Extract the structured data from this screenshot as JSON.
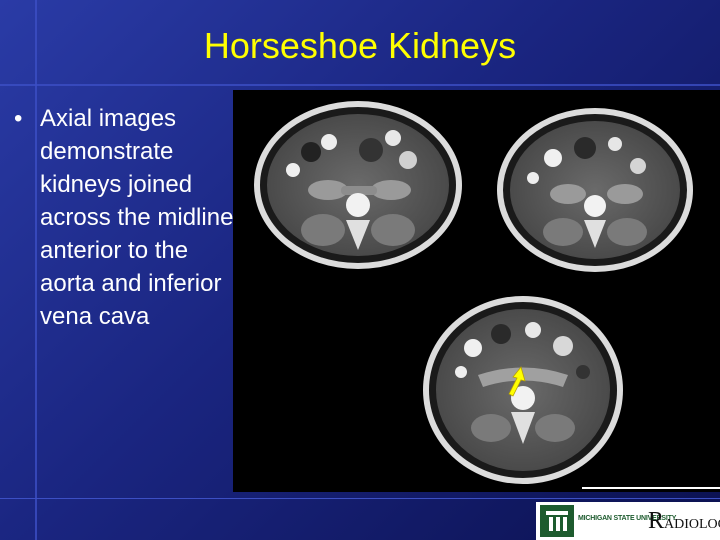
{
  "slide": {
    "title": "Horseshoe Kidneys",
    "bullets": [
      {
        "marker": "•",
        "text": "Axial images demonstrate kidneys joined across the midline anterior to the aorta and inferior vena cava"
      }
    ]
  },
  "images": [
    {
      "name": "axial-ct-upper-left",
      "has_arrow": false
    },
    {
      "name": "axial-ct-upper-right",
      "has_arrow": false
    },
    {
      "name": "axial-ct-lower",
      "has_arrow": true,
      "arrow_color": "#ffff00"
    }
  ],
  "logo": {
    "university": "MICHIGAN STATE UNIVERSITY",
    "dept_initial": "R",
    "dept_rest": "ADIOLOGY",
    "brand_color": "#1d5b2e"
  },
  "colors": {
    "title": "#ffff00",
    "text": "#ffffff",
    "background": "#1a2580"
  }
}
